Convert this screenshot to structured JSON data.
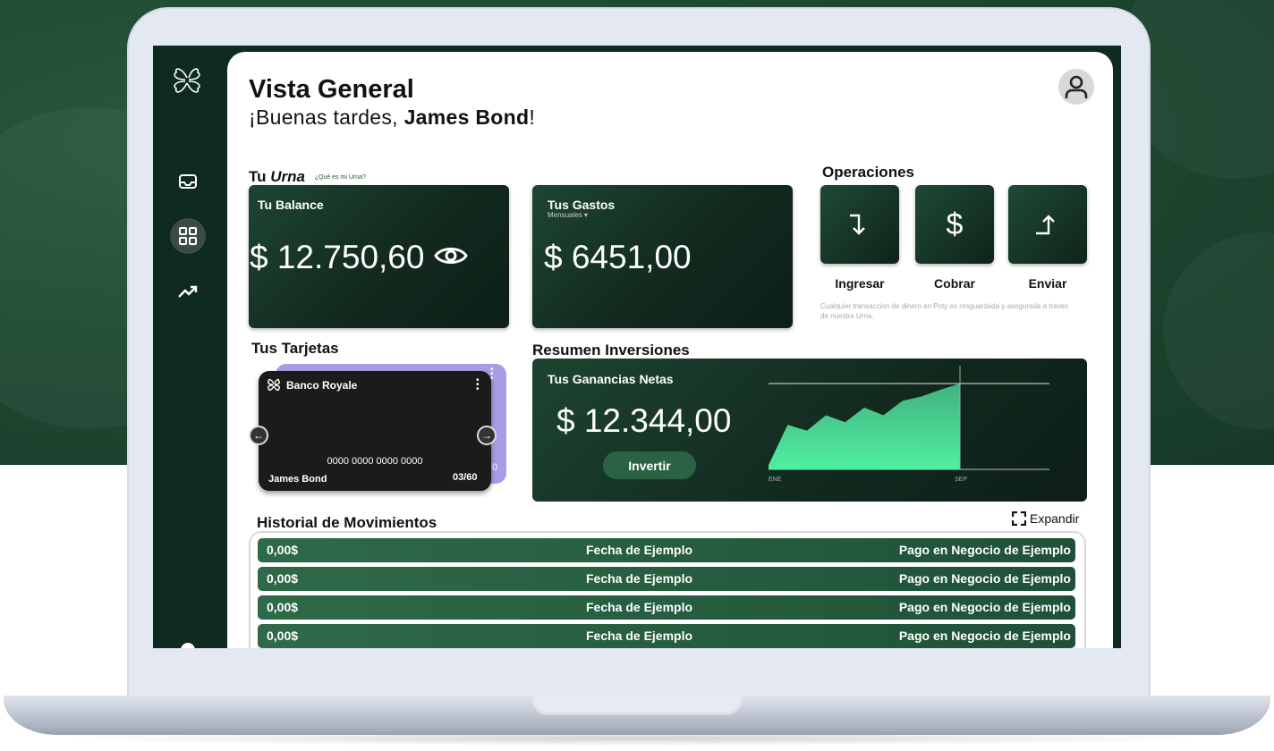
{
  "page": {
    "title": "Vista General",
    "greeting_prefix": "¡Buenas tardes,",
    "user_name": "James Bond",
    "greeting_suffix": "!"
  },
  "sidebar": {
    "items": [
      {
        "name": "inbox",
        "icon": "inbox-icon"
      },
      {
        "name": "dashboard",
        "icon": "grid-icon",
        "active": true
      },
      {
        "name": "investments",
        "icon": "trending-up-icon"
      },
      {
        "name": "settings",
        "icon": "gear-icon"
      }
    ]
  },
  "urna": {
    "label_prefix": "Tu",
    "label_emph": "Urna",
    "help_text": "¿Qué es mi Urna?"
  },
  "balance": {
    "label": "Tu Balance",
    "amount": "$ 12.750,60"
  },
  "gastos": {
    "label": "Tus Gastos",
    "period": "Mensuales",
    "amount": "$ 6451,00"
  },
  "operaciones": {
    "title": "Operaciones",
    "buttons": [
      {
        "label": "Ingresar",
        "icon": "arrow-turn-down-icon"
      },
      {
        "label": "Cobrar",
        "icon": "dollar-icon"
      },
      {
        "label": "Enviar",
        "icon": "arrow-turn-up-icon"
      }
    ],
    "note": "Cualquier transaccion de dinero en Poty es resguardada y asegurada a traves de nuestra Urna."
  },
  "tarjetas": {
    "title": "Tus Tarjetas",
    "card": {
      "bank": "Banco Royale",
      "number": "0000 0000 0000 0000",
      "holder": "James Bond",
      "expiry": "03/60"
    }
  },
  "inversiones": {
    "title": "Resumen Inversiones",
    "label": "Tus Ganancias Netas",
    "amount": "$ 12.344,00",
    "button": "Invertir"
  },
  "chart_data": {
    "type": "area",
    "x": [
      "ENE",
      "",
      "",
      "",
      "",
      "",
      "",
      "",
      "SEP"
    ],
    "x_tick_labels": [
      "ENE",
      "SEP"
    ],
    "values": [
      0.05,
      0.52,
      0.45,
      0.63,
      0.55,
      0.72,
      0.63,
      0.8,
      0.85,
      0.93,
      1.0
    ],
    "title": "",
    "xlabel": "",
    "ylabel": "",
    "grid": false,
    "colors": {
      "fill_top": "#4fd69a",
      "fill_bottom": "#4ff0a0",
      "line": "#e6e6e6"
    }
  },
  "historial": {
    "title": "Historial de Movimientos",
    "expand_label": "Expandir",
    "rows": [
      {
        "amount": "0,00$",
        "date": "Fecha de Ejemplo",
        "desc": "Pago en Negocio de Ejemplo"
      },
      {
        "amount": "0,00$",
        "date": "Fecha de Ejemplo",
        "desc": "Pago en Negocio de Ejemplo"
      },
      {
        "amount": "0,00$",
        "date": "Fecha de Ejemplo",
        "desc": "Pago en Negocio de Ejemplo"
      },
      {
        "amount": "0,00$",
        "date": "Fecha de Ejemplo",
        "desc": "Pago en Negocio de Ejemplo"
      }
    ]
  },
  "colors": {
    "brand_dark": "#0f2a1f",
    "brand_green": "#2e6a49",
    "card_purple": "#a99be6"
  }
}
